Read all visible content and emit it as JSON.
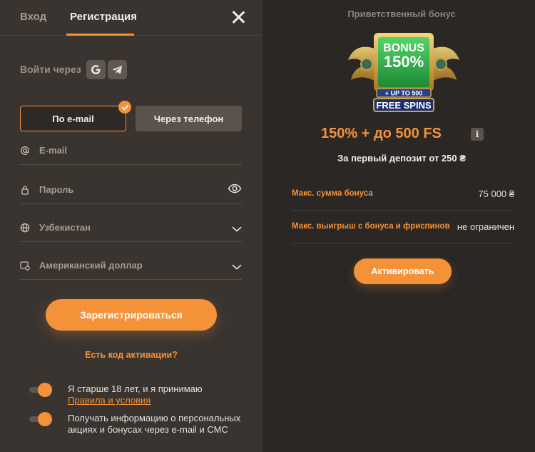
{
  "tabs": {
    "login": "Вход",
    "register": "Регистрация"
  },
  "social": {
    "label": "Войти через",
    "icons": [
      "google-icon",
      "telegram-icon"
    ]
  },
  "method": {
    "email": "По e-mail",
    "phone": "Через телефон",
    "selected": "email"
  },
  "fields": {
    "email": "E-mail",
    "password": "Пароль",
    "country": "Узбекистан",
    "currency": "Американский доллар"
  },
  "register_button": "Зарегистрироваться",
  "promo_code_link": "Есть код активации?",
  "consents": {
    "age_text": "Я старше 18 лет, и я принимаю",
    "age_link": "Правила и условия",
    "age_on": true,
    "marketing_line1": "Получать информацию о персональных",
    "marketing_line2": "акциях и бонусах через e-mail и СМС",
    "marketing_on": true
  },
  "bonus": {
    "title": "Приветственный бонус",
    "image_text_1": "BONUS",
    "image_text_2": "150%",
    "image_text_3": "+ UP TO 500",
    "image_text_4": "FREE SPINS",
    "headline": "150% + до 500 FS",
    "info": "i",
    "subline": "За первый депозит от 250 ₴",
    "rows": [
      {
        "label": "Макс. сумма бонуса",
        "value": "75 000 ₴"
      },
      {
        "label": "Макс. выигрыш с бонуса и фриспинов",
        "value": "не ограничен"
      }
    ],
    "activate_button": "Активировать"
  },
  "colors": {
    "accent": "#f4923a",
    "panel": "#3a3430",
    "background": "#2b2724"
  }
}
